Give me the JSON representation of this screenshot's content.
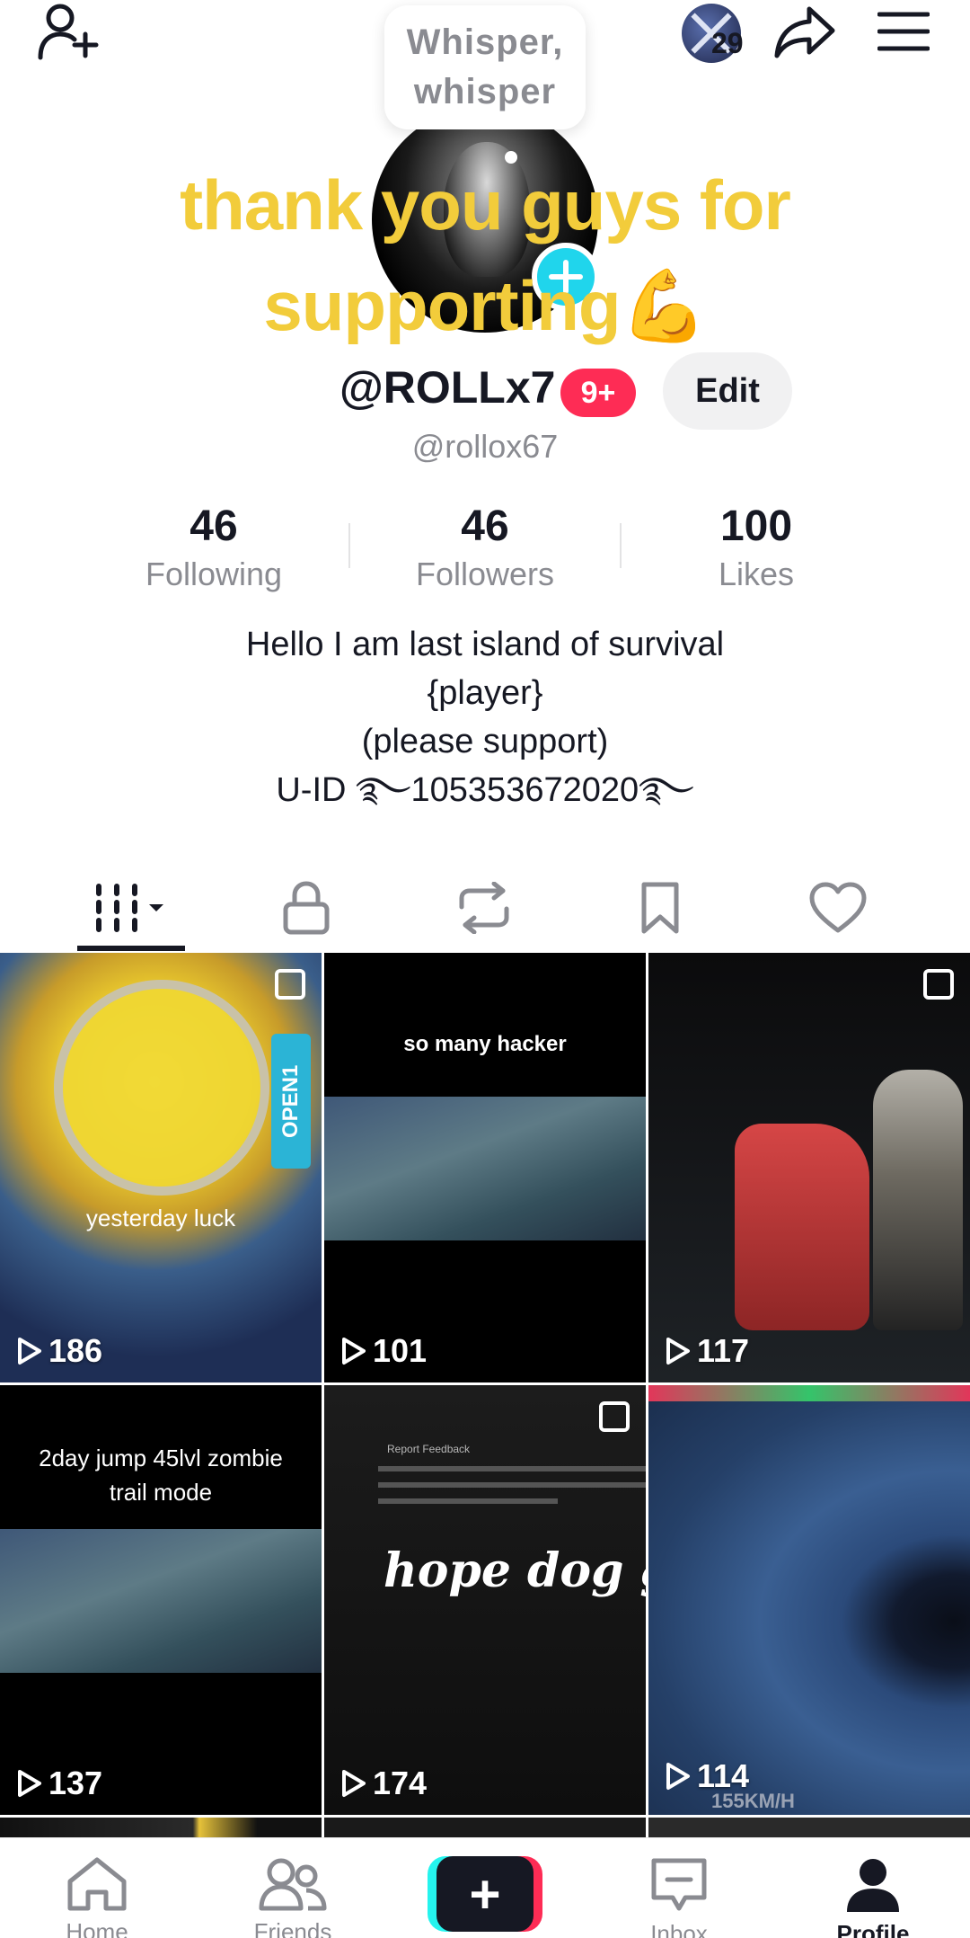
{
  "topbar": {
    "add_friend_icon": "add-user-icon",
    "avatar_badge_count": "29",
    "share_icon": "share-icon",
    "menu_icon": "hamburger-icon"
  },
  "profile": {
    "whisper_bubble": "Whisper, whisper",
    "caption": "thank you guys for supporting💪",
    "username": "@ROLLx7",
    "notification_badge": "9+",
    "edit_label": "Edit",
    "handle": "@rollox67"
  },
  "stats": [
    {
      "value": "46",
      "label": "Following"
    },
    {
      "value": "46",
      "label": "Followers"
    },
    {
      "value": "100",
      "label": "Likes"
    }
  ],
  "bio": {
    "line1": "Hello I am last island of survival",
    "line2": "{player}",
    "line3": "(please support)",
    "line4": "U-ID ࿐105353672020࿐"
  },
  "tabs": [
    {
      "name": "videos",
      "icon": "grid-icon",
      "active": true
    },
    {
      "name": "private",
      "icon": "lock-icon"
    },
    {
      "name": "reposts",
      "icon": "repost-icon"
    },
    {
      "name": "favorites",
      "icon": "bookmark-icon"
    },
    {
      "name": "liked",
      "icon": "heart-icon"
    }
  ],
  "videos": [
    {
      "caption": "yesterday luck",
      "side_label": "OPEN1",
      "views": "186",
      "multi": true
    },
    {
      "caption": "so many hacker",
      "views": "101",
      "multi": false
    },
    {
      "caption": "",
      "views": "117",
      "multi": true
    },
    {
      "caption": "2day jump 45lvl zombie trail mode",
      "views": "137",
      "multi": false
    },
    {
      "caption": "hope dog g",
      "views": "174",
      "multi": true,
      "doc_title": "Report Feedback"
    },
    {
      "caption": "",
      "views": "114",
      "multi": false,
      "overlay_text": "155KM/H"
    }
  ],
  "nav": {
    "home": "Home",
    "friends": "Friends",
    "create": "+",
    "inbox": "Inbox",
    "profile": "Profile"
  },
  "colors": {
    "accent": "#fe2c55",
    "cyan": "#25f4ee",
    "caption_yellow": "#f2cc3b",
    "muted": "#8a8b91"
  }
}
